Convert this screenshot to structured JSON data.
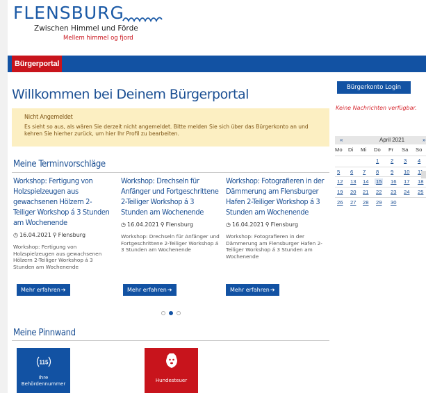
{
  "logo": {
    "wordmark": "FLENSBURG",
    "subtitle": "Zwischen Himmel und Förde",
    "subtitle_danish": "Mellem himmel og fjord"
  },
  "nav": {
    "active_tab": "Bürgerportal"
  },
  "main": {
    "title": "Willkommen bei Deinem Bürgerportal",
    "alert": {
      "title": "Nicht Angemeldet",
      "text": "Es sieht so aus, als wären Sie derzeit nicht angemeldet. Bitte melden Sie sich über das Bürgerkonto an und kehren Sie hierher zurück, um hier Ihr Profil zu bearbeiten."
    },
    "termine": {
      "heading": "Meine Terminvorschläge",
      "cards": [
        {
          "title": "Workshop: Fertigung von Holzspielzeugen aus gewachsenen Hölzern 2-Teiliger Workshop á 3 Stunden am Wochenende",
          "date": "16.04.2021",
          "location": "Flensburg",
          "description": "Workshop: Fertigung von Holzspielzeugen aus gewachsenen Hölzern 2-Teiliger Workshop á 3 Stunden am Wochenende",
          "button": "Mehr erfahren"
        },
        {
          "title": "Workshop: Drechseln für Anfänger und Fortgeschrittene 2-Teiliger Workshop á 3 Stunden am Wochenende",
          "date": "16.04.2021",
          "location": "Flensburg",
          "description": "Workshop: Drechseln für Anfänger und Fortgeschrittene 2-Teiliger Workshop á 3 Stunden am Wochenende",
          "button": "Mehr erfahren"
        },
        {
          "title": "Workshop: Fotografieren in der Dämmerung am Flensburger Hafen 2-Teiliger Workshop á 3 Stunden am Wochenende",
          "date": "16.04.2021",
          "location": "Flensburg",
          "description": "Workshop: Fotografieren in der Dämmerung am Flensburger Hafen 2-Teiliger Workshop á 3 Stunden am Wochenende",
          "button": "Mehr erfahren"
        }
      ],
      "carousel_active_index": 1,
      "carousel_count": 3
    },
    "pinnwand": {
      "heading": "Meine Pinnwand",
      "tiles": [
        {
          "icon": "115-phone-icon",
          "label_line1": "Ihre",
          "label_line2": "Behördennummer",
          "badge": "115",
          "color": "#1252a3"
        },
        {
          "icon": "dog-icon",
          "label_line1": "Hundesteuer",
          "color": "#c8141c"
        }
      ]
    }
  },
  "sidebar": {
    "login_button": "Bürgerkonto Login",
    "no_messages": "Keine Nachrichten verfügbar.",
    "calendar": {
      "prev": "«",
      "next": "»",
      "month": "April 2021",
      "weekdays": [
        "Mo",
        "Di",
        "Mi",
        "Do",
        "Fr",
        "Sa",
        "So"
      ],
      "weeks": [
        [
          "",
          "",
          "",
          "1",
          "2",
          "3",
          "4"
        ],
        [
          "5",
          "6",
          "7",
          "8",
          "9",
          "10",
          "11"
        ],
        [
          "12",
          "13",
          "14",
          "15",
          "16",
          "17",
          "18"
        ],
        [
          "19",
          "20",
          "21",
          "22",
          "23",
          "24",
          "25"
        ],
        [
          "26",
          "27",
          "28",
          "29",
          "30",
          "",
          ""
        ]
      ],
      "today": "15"
    }
  },
  "colors": {
    "brand_blue": "#1252a3",
    "brand_red": "#c8141c",
    "alert_bg": "#fcefc2"
  }
}
